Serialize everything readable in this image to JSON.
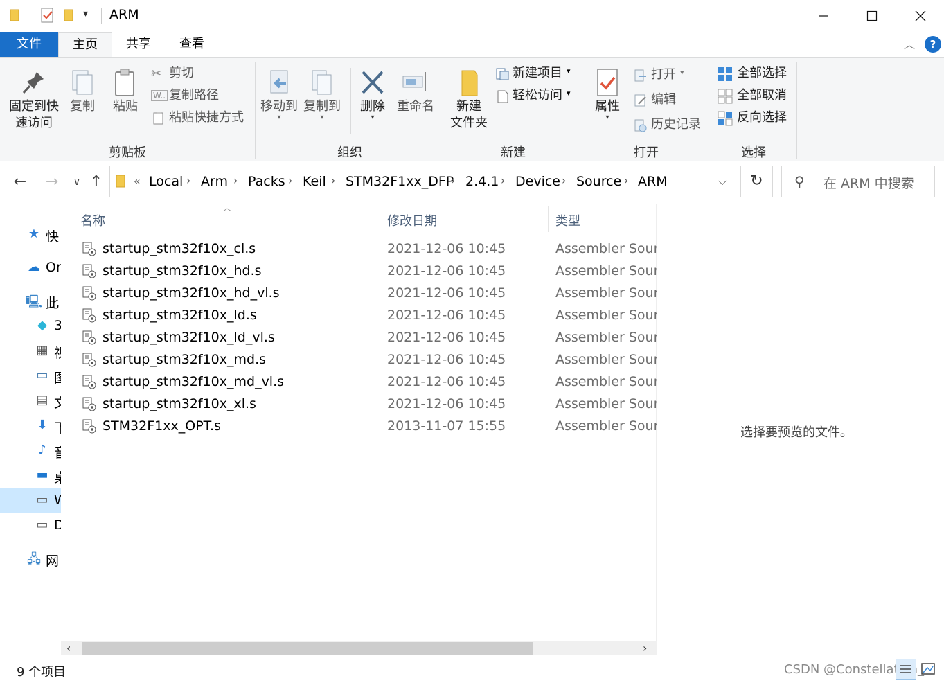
{
  "window": {
    "title": "ARM"
  },
  "tabs": {
    "file": "文件",
    "home": "主页",
    "share": "共享",
    "view": "查看"
  },
  "ribbon": {
    "clipboard": {
      "pin": [
        "固定到快",
        "速访问"
      ],
      "copy": "复制",
      "paste": "粘贴",
      "cut": "剪切",
      "copy_path": "复制路径",
      "paste_shortcut": "粘贴快捷方式",
      "group": "剪贴板"
    },
    "organize": {
      "move_to": "移动到",
      "copy_to": "复制到",
      "delete": "删除",
      "rename": "重命名",
      "group": "组织"
    },
    "new": {
      "new_folder": [
        "新建",
        "文件夹"
      ],
      "new_item": "新建项目",
      "easy_access": "轻松访问",
      "group": "新建"
    },
    "open": {
      "properties": "属性",
      "open": "打开",
      "edit": "编辑",
      "history": "历史记录",
      "group": "打开"
    },
    "select": {
      "select_all": "全部选择",
      "select_none": "全部取消",
      "invert": "反向选择",
      "group": "选择"
    }
  },
  "address": {
    "overflow": "«",
    "crumbs": [
      "Local",
      "Arm",
      "Packs",
      "Keil",
      "STM32F1xx_DFP",
      "2.4.1",
      "Device",
      "Source",
      "ARM"
    ]
  },
  "search": {
    "placeholder": "在 ARM 中搜索"
  },
  "navpane": {
    "items": [
      {
        "label": "快",
        "icon": "star-icon"
      },
      {
        "label": "Or",
        "icon": "cloud-icon"
      },
      {
        "label": "此",
        "icon": "computer-icon"
      },
      {
        "label": "3",
        "icon": "cube-icon"
      },
      {
        "label": "视",
        "icon": "film-icon"
      },
      {
        "label": "图",
        "icon": "picture-icon"
      },
      {
        "label": "文",
        "icon": "document-icon"
      },
      {
        "label": "下",
        "icon": "download-icon"
      },
      {
        "label": "音",
        "icon": "music-icon"
      },
      {
        "label": "桌",
        "icon": "desktop-icon"
      },
      {
        "label": "W",
        "icon": "drive-icon"
      },
      {
        "label": "D",
        "icon": "drive-icon"
      },
      {
        "label": "网",
        "icon": "network-icon"
      }
    ]
  },
  "filelist": {
    "columns": {
      "name": "名称",
      "date": "修改日期",
      "type": "类型"
    },
    "files": [
      {
        "name": "startup_stm32f10x_cl.s",
        "date": "2021-12-06 10:45",
        "type": "Assembler Source"
      },
      {
        "name": "startup_stm32f10x_hd.s",
        "date": "2021-12-06 10:45",
        "type": "Assembler Source"
      },
      {
        "name": "startup_stm32f10x_hd_vl.s",
        "date": "2021-12-06 10:45",
        "type": "Assembler Source"
      },
      {
        "name": "startup_stm32f10x_ld.s",
        "date": "2021-12-06 10:45",
        "type": "Assembler Source"
      },
      {
        "name": "startup_stm32f10x_ld_vl.s",
        "date": "2021-12-06 10:45",
        "type": "Assembler Source"
      },
      {
        "name": "startup_stm32f10x_md.s",
        "date": "2021-12-06 10:45",
        "type": "Assembler Source"
      },
      {
        "name": "startup_stm32f10x_md_vl.s",
        "date": "2021-12-06 10:45",
        "type": "Assembler Source"
      },
      {
        "name": "startup_stm32f10x_xl.s",
        "date": "2021-12-06 10:45",
        "type": "Assembler Source"
      },
      {
        "name": "STM32F1xx_OPT.s",
        "date": "2013-11-07 15:55",
        "type": "Assembler Source"
      }
    ]
  },
  "preview": {
    "text": "选择要预览的文件。"
  },
  "status": {
    "count": "9 个项目",
    "watermark": "CSDN @Constellation_"
  },
  "colors": {
    "accent": "#1a6fc9",
    "ribbon_bg": "#f5f6f7",
    "selection": "#cce8ff"
  }
}
